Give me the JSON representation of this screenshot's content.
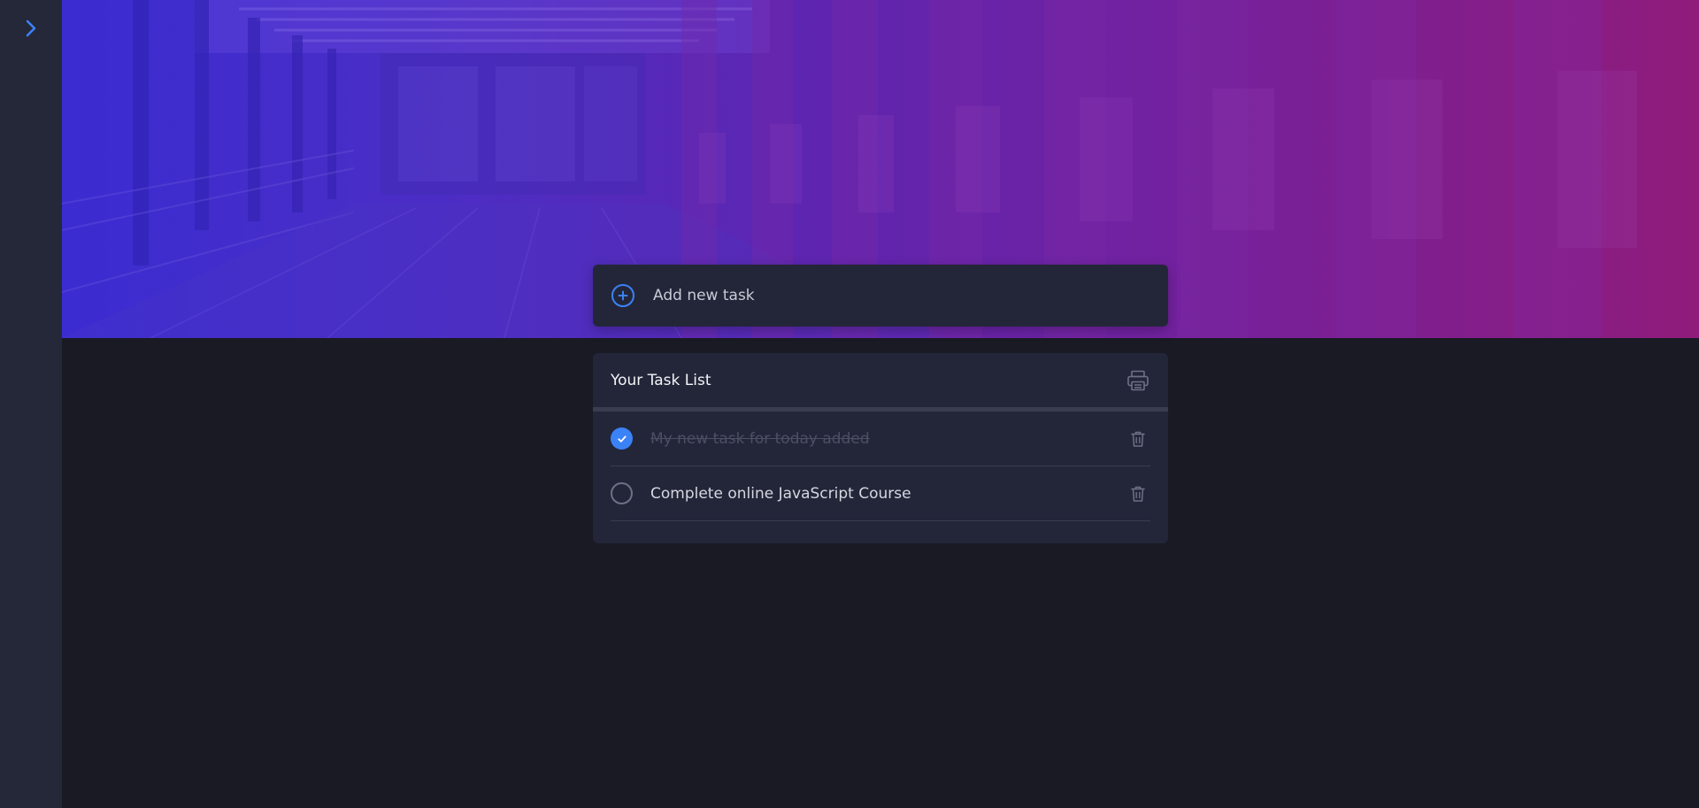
{
  "colors": {
    "background": "#191a24",
    "sidebar": "#252838",
    "card": "#232639",
    "accent": "#3b82f6",
    "hero_gradient_start": "#3b2bcf",
    "hero_gradient_end": "#8a1d7c"
  },
  "sidebar": {
    "toggle_icon": "chevron-right-icon"
  },
  "add_task": {
    "icon": "plus-circle-icon",
    "placeholder": "Add new task"
  },
  "task_list": {
    "title": "Your Task List",
    "print_icon": "printer-icon",
    "tasks": [
      {
        "text": "My new task for today added",
        "completed": true
      },
      {
        "text": "Complete online JavaScript Course",
        "completed": false
      }
    ]
  }
}
